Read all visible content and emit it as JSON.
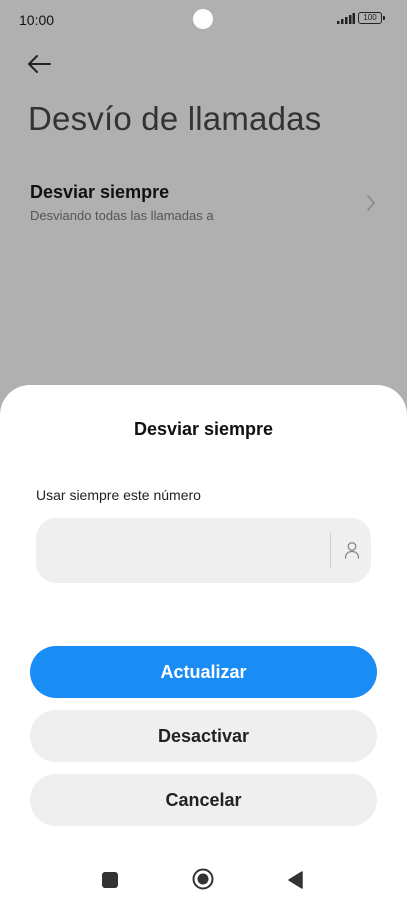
{
  "status_bar": {
    "time": "10:00",
    "battery": "100"
  },
  "header": {
    "title": "Desvío de llamadas"
  },
  "settings": {
    "forward_always": {
      "title": "Desviar siempre",
      "subtitle": "Desviando todas las llamadas a"
    }
  },
  "dialog": {
    "title": "Desviar siempre",
    "field_label": "Usar siempre este número",
    "number_value": "",
    "update_label": "Actualizar",
    "deactivate_label": "Desactivar",
    "cancel_label": "Cancelar"
  },
  "colors": {
    "accent": "#1a8cf5",
    "overlay": "#b0b0b0",
    "secondary_button": "#efefef"
  },
  "icons": {
    "back": "arrow-left-icon",
    "chevron": "chevron-right-icon",
    "contact": "contact-person-icon",
    "nav_recents": "square-icon",
    "nav_home": "circle-icon",
    "nav_back": "triangle-back-icon"
  }
}
